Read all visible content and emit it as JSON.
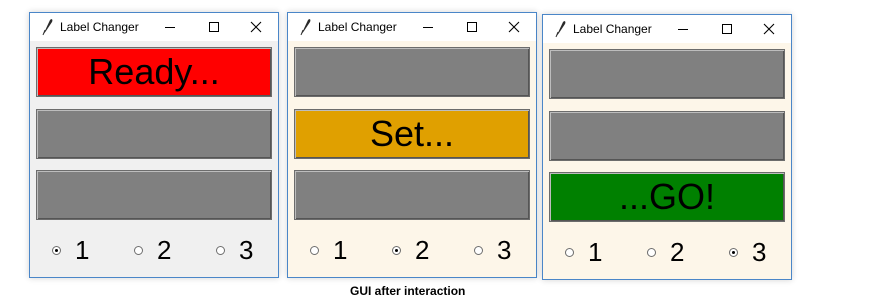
{
  "caption": "GUI after interaction",
  "colors": {
    "red": "#ff0000",
    "amber": "#e0a000",
    "green": "#008000",
    "grey": "#808080"
  },
  "icons": {
    "app": "feather-icon",
    "minimize": "minimize-icon",
    "maximize": "maximize-icon",
    "close": "close-icon"
  },
  "windows": [
    {
      "title": "Label Changer",
      "labels": [
        {
          "text": "Ready...",
          "color": "#ff0000"
        },
        {
          "text": "",
          "color": "#808080"
        },
        {
          "text": "",
          "color": "#808080"
        }
      ],
      "radios": [
        {
          "label": "1",
          "selected": true
        },
        {
          "label": "2",
          "selected": false
        },
        {
          "label": "3",
          "selected": false
        }
      ]
    },
    {
      "title": "Label Changer",
      "labels": [
        {
          "text": "",
          "color": "#808080"
        },
        {
          "text": "Set...",
          "color": "#e0a000"
        },
        {
          "text": "",
          "color": "#808080"
        }
      ],
      "radios": [
        {
          "label": "1",
          "selected": false
        },
        {
          "label": "2",
          "selected": true
        },
        {
          "label": "3",
          "selected": false
        }
      ]
    },
    {
      "title": "Label Changer",
      "labels": [
        {
          "text": "",
          "color": "#808080"
        },
        {
          "text": "",
          "color": "#808080"
        },
        {
          "text": "...GO!",
          "color": "#008000"
        }
      ],
      "radios": [
        {
          "label": "1",
          "selected": false
        },
        {
          "label": "2",
          "selected": false
        },
        {
          "label": "3",
          "selected": true
        }
      ]
    }
  ]
}
